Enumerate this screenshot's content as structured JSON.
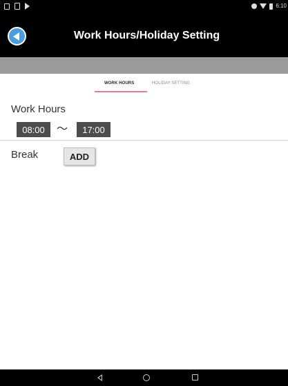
{
  "status_bar": {
    "time": "6:10",
    "left_icons": [
      "notification-icon",
      "sd-card-icon",
      "play-icon"
    ],
    "right_icons": [
      "data-saver-icon",
      "wifi-icon",
      "battery-icon"
    ]
  },
  "app_bar": {
    "title": "Work Hours/Holiday Setting",
    "back_icon": "back-arrow-icon",
    "accent_color": "#4a9ee0"
  },
  "tabs": [
    {
      "label": "WORK HOURS",
      "active": true
    },
    {
      "label": "HOLIDAY SETTING",
      "active": false
    }
  ],
  "tab_indicator_color": "#e07a9a",
  "work_hours": {
    "label": "Work Hours",
    "start": "08:00",
    "separator": "〜",
    "end": "17:00"
  },
  "break": {
    "label": "Break",
    "add_label": "ADD"
  },
  "nav_bar": {
    "icons": [
      "nav-back-icon",
      "nav-home-icon",
      "nav-recent-apps-icon"
    ]
  }
}
